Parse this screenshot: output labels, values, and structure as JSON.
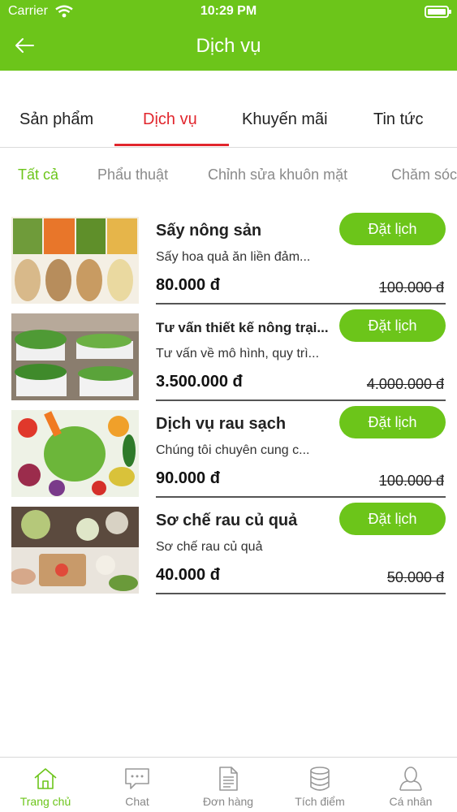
{
  "status": {
    "carrier": "Carrier",
    "time": "10:29 PM"
  },
  "header": {
    "title": "Dịch vụ"
  },
  "tabs": [
    {
      "label": "Sản phẩm"
    },
    {
      "label": "Dịch vụ"
    },
    {
      "label": "Khuyến mãi"
    },
    {
      "label": "Tin tức"
    }
  ],
  "filters": [
    {
      "label": "Tất cả"
    },
    {
      "label": "Phẩu thuật"
    },
    {
      "label": "Chỉnh sửa khuôn mặt"
    },
    {
      "label": "Chăm sóc"
    }
  ],
  "services": [
    {
      "name": "Sấy nông sản",
      "desc": "Sấy hoa quả ăn liền đảm...",
      "price": "80.000 đ",
      "old_price": "100.000 đ",
      "book": "Đặt lịch"
    },
    {
      "name": "Tư vấn thiết kế nông trại...",
      "desc": "Tư vấn về mô hình, quy trì...",
      "price": "3.500.000 đ",
      "old_price": "4.000.000 đ",
      "book": "Đặt lịch"
    },
    {
      "name": "Dịch vụ rau sạch",
      "desc": "Chúng tôi chuyên cung c...",
      "price": "90.000 đ",
      "old_price": "100.000 đ",
      "book": "Đặt lịch"
    },
    {
      "name": "Sơ chế rau củ quả",
      "desc": "Sơ chế rau củ quả",
      "price": "40.000 đ",
      "old_price": "50.000 đ",
      "book": "Đặt lịch"
    }
  ],
  "bottom_nav": [
    {
      "label": "Trang chủ",
      "icon": "home-icon"
    },
    {
      "label": "Chat",
      "icon": "chat-icon"
    },
    {
      "label": "Đơn hàng",
      "icon": "document-icon"
    },
    {
      "label": "Tích điểm",
      "icon": "coins-icon"
    },
    {
      "label": "Cá nhân",
      "icon": "person-icon"
    }
  ],
  "colors": {
    "accent": "#6cc51a",
    "active_tab": "#e1262d"
  }
}
